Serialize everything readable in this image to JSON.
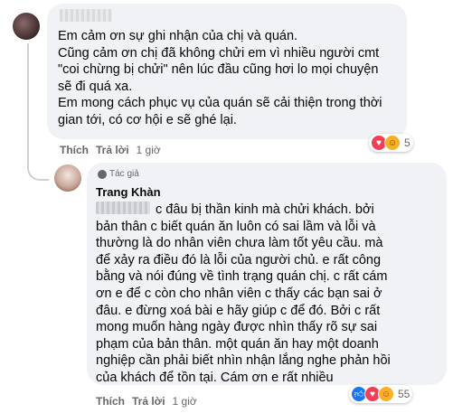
{
  "comment1": {
    "lines": [
      "Em cảm ơn sự ghi nhận của chị và quán.",
      "Cũng cảm ơn chị đã không chửi em vì nhiều người cmt",
      "\"coi chừng bị chửi\" nên lúc đầu cũng hơi lo mọi chuyện",
      "sẽ đi quá xa.",
      "Em mong cách phục vụ của quán sẽ cải thiện trong thời",
      "gian tới, có cơ hội e sẽ ghé lại."
    ],
    "actions": {
      "like": "Thích",
      "reply": "Trả lời",
      "time": "1 giờ"
    },
    "reaction_count": "5",
    "reaction_icons": [
      "love-icon",
      "haha-icon"
    ]
  },
  "comment2": {
    "badge": "Tác giả",
    "author": "Trang Khàn",
    "lines": [
      "c đâu bị thần kinh mà chửi khách. bởi",
      "bản thân c biết quán ăn luôn có sai lầm và lỗi và",
      "thường là do nhân viên chưa làm tốt yêu cầu. mà",
      "để xảy ra điều đó là lỗi của người chủ. e rất công",
      "bằng và nói đúng về tình trạng quán chị. c rất cám",
      "ơn e để c còn cho nhân viên c thấy các bạn sai ở",
      "đâu. e đừng xoá bài e hãy giúp c để đó. Bởi c rất",
      "mong muốn hàng ngày được nhìn thấy rõ sự sai",
      "phạm của bản thân. một quán ăn hay một doanh",
      "nghiệp cần phải biết nhìn nhận lắng nghe phản hồi",
      "của khách để tồn tại. Cám ơn e rất nhiều"
    ],
    "actions": {
      "like": "Thích",
      "reply": "Trả lời",
      "time": "1 giờ"
    },
    "reaction_count": "55",
    "reaction_icons": [
      "like-icon",
      "love-icon",
      "care-icon"
    ]
  },
  "colors": {
    "bubble": "#f0f2f5",
    "meta_text": "#65676b",
    "like_blue": "#1877f2",
    "love_red": "#f33e58",
    "haha_yellow": "#f7b125"
  }
}
